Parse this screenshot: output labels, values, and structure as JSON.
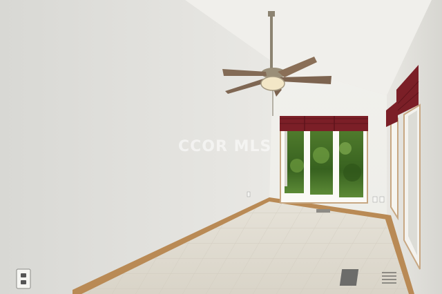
{
  "photo": {
    "watermark": "CCOR MLS"
  }
}
